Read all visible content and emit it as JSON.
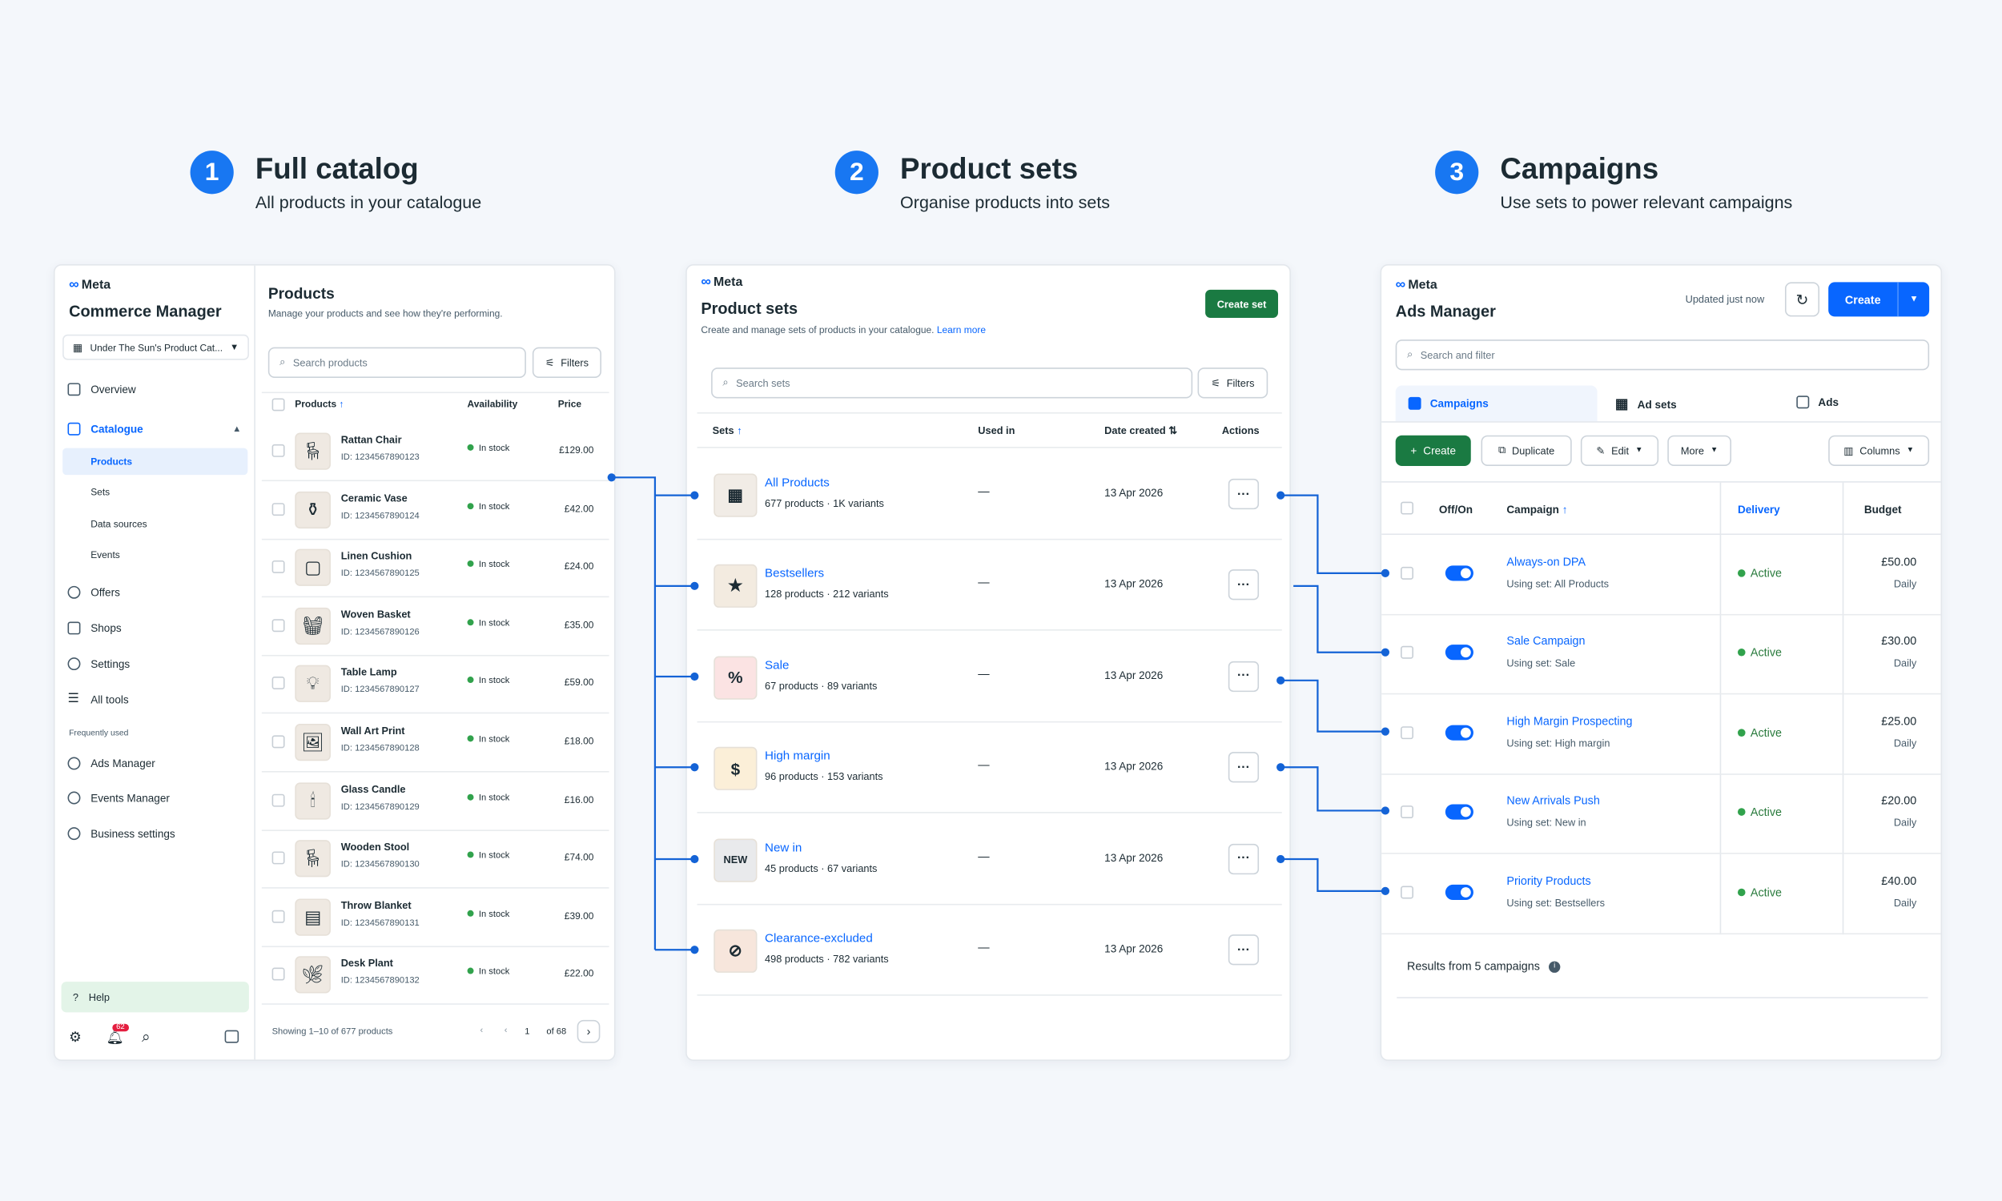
{
  "steps": [
    {
      "num": "1",
      "title": "Full catalog",
      "subtitle": "All products in your catalogue"
    },
    {
      "num": "2",
      "title": "Product sets",
      "subtitle": "Organise products into sets"
    },
    {
      "num": "3",
      "title": "Campaigns",
      "subtitle": "Use sets to power relevant campaigns"
    }
  ],
  "commerce": {
    "brand": "Meta",
    "app_title": "Commerce Manager",
    "catalog_selector": "Under The Sun's Product Cat...",
    "nav": [
      {
        "label": "Overview",
        "icon": "home-icon"
      },
      {
        "label": "Catalogue",
        "icon": "catalogue-icon"
      },
      {
        "label": "Offers",
        "icon": "tag-icon"
      },
      {
        "label": "Shops",
        "icon": "shop-icon"
      },
      {
        "label": "Settings",
        "icon": "gear-icon"
      },
      {
        "label": "All tools",
        "icon": "menu-icon"
      }
    ],
    "catalogue_sub": [
      "Products",
      "Sets",
      "Data sources",
      "Events"
    ],
    "frequently_used_label": "Frequently used",
    "frequent": [
      {
        "label": "Ads Manager",
        "icon": "ads-icon"
      },
      {
        "label": "Events Manager",
        "icon": "events-icon"
      },
      {
        "label": "Business settings",
        "icon": "gear-icon"
      }
    ],
    "help": "Help",
    "notif_count": "62",
    "products_title": "Products",
    "products_subtitle": "Manage your products and see how they're performing.",
    "search_placeholder": "Search products",
    "filters": "Filters",
    "columns": [
      "Products",
      "Availability",
      "Price"
    ],
    "rows": [
      {
        "name": "Rattan Chair",
        "id": "ID: 1234567890123",
        "avail": "In stock",
        "price": "£129.00"
      },
      {
        "name": "Ceramic Vase",
        "id": "ID: 1234567890124",
        "avail": "In stock",
        "price": "£42.00"
      },
      {
        "name": "Linen Cushion",
        "id": "ID: 1234567890125",
        "avail": "In stock",
        "price": "£24.00"
      },
      {
        "name": "Woven Basket",
        "id": "ID: 1234567890126",
        "avail": "In stock",
        "price": "£35.00"
      },
      {
        "name": "Table Lamp",
        "id": "ID: 1234567890127",
        "avail": "In stock",
        "price": "£59.00"
      },
      {
        "name": "Wall Art Print",
        "id": "ID: 1234567890128",
        "avail": "In stock",
        "price": "£18.00"
      },
      {
        "name": "Glass Candle",
        "id": "ID: 1234567890129",
        "avail": "In stock",
        "price": "£16.00"
      },
      {
        "name": "Wooden Stool",
        "id": "ID: 1234567890130",
        "avail": "In stock",
        "price": "£74.00"
      },
      {
        "name": "Throw Blanket",
        "id": "ID: 1234567890131",
        "avail": "In stock",
        "price": "£39.00"
      },
      {
        "name": "Desk Plant",
        "id": "ID: 1234567890132",
        "avail": "In stock",
        "price": "£22.00"
      }
    ],
    "showing": "Showing 1–10 of 677 products",
    "page": "1",
    "of_pages": "of 68"
  },
  "sets": {
    "brand": "Meta",
    "title": "Product sets",
    "subtitle": "Create and manage sets of products in your catalogue.",
    "learn_more": "Learn more",
    "create_btn": "Create set",
    "search_placeholder": "Search sets",
    "filters": "Filters",
    "columns": [
      "Sets",
      "Used in",
      "Date created",
      "Actions"
    ],
    "rows": [
      {
        "name": "All Products",
        "meta": "677 products · 1K variants",
        "used": "—",
        "date": "13 Apr 2026"
      },
      {
        "name": "Bestsellers",
        "meta": "128 products · 212 variants",
        "used": "—",
        "date": "13 Apr 2026"
      },
      {
        "name": "Sale",
        "meta": "67 products · 89 variants",
        "used": "—",
        "date": "13 Apr 2026"
      },
      {
        "name": "High margin",
        "meta": "96 products · 153 variants",
        "used": "—",
        "date": "13 Apr 2026"
      },
      {
        "name": "New in",
        "meta": "45 products · 67 variants",
        "used": "—",
        "date": "13 Apr 2026"
      },
      {
        "name": "Clearance-excluded",
        "meta": "498 products · 782 variants",
        "used": "—",
        "date": "13 Apr 2026"
      }
    ],
    "action_glyph": "···"
  },
  "ads": {
    "brand": "Meta",
    "app_title": "Ads Manager",
    "updated": "Updated just now",
    "create_btn": "Create",
    "search_placeholder": "Search and filter",
    "tabs": [
      "Campaigns",
      "Ad sets",
      "Ads"
    ],
    "toolbar": {
      "create": "Create",
      "duplicate": "Duplicate",
      "edit": "Edit",
      "more": "More",
      "columns": "Columns"
    },
    "columns": [
      "Off/On",
      "Campaign",
      "Delivery",
      "Budget"
    ],
    "rows": [
      {
        "name": "Always-on DPA",
        "set": "Using set: All Products",
        "delivery": "Active",
        "budget": "£50.00",
        "period": "Daily"
      },
      {
        "name": "Sale Campaign",
        "set": "Using set: Sale",
        "delivery": "Active",
        "budget": "£30.00",
        "period": "Daily"
      },
      {
        "name": "High Margin Prospecting",
        "set": "Using set: High margin",
        "delivery": "Active",
        "budget": "£25.00",
        "period": "Daily"
      },
      {
        "name": "New Arrivals Push",
        "set": "Using set: New in",
        "delivery": "Active",
        "budget": "£20.00",
        "period": "Daily"
      },
      {
        "name": "Priority Products",
        "set": "Using set: Bestsellers",
        "delivery": "Active",
        "budget": "£40.00",
        "period": "Daily"
      }
    ],
    "results": "Results from 5 campaigns"
  },
  "colors": {
    "accent": "#1877f2",
    "link": "#0866ff",
    "create_green": "#1a7a42",
    "active_green": "#31a24c",
    "connector": "#1463d6"
  }
}
